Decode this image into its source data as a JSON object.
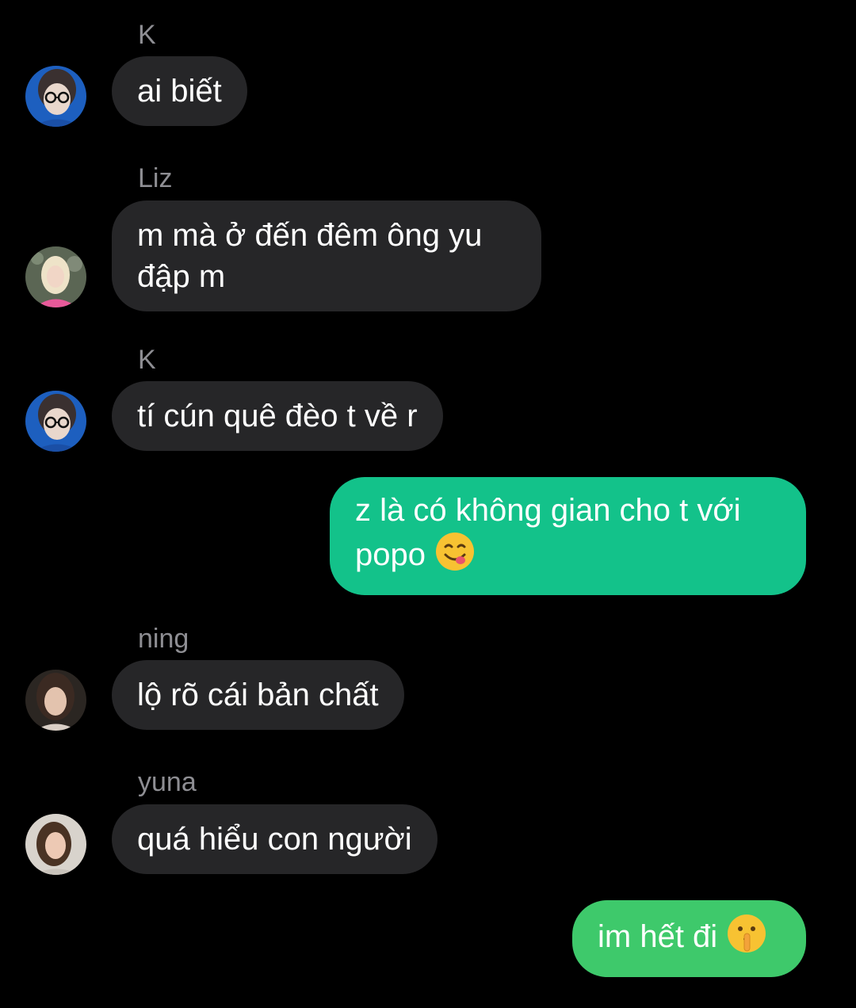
{
  "messages": [
    {
      "sender": "K",
      "text": "ai biết",
      "avatar": "avatar-k"
    },
    {
      "sender": "Liz",
      "text": "m mà ở đến đêm ông yu đập m",
      "avatar": "avatar-liz"
    },
    {
      "sender": "K",
      "text": "tí cún quê đèo t về r",
      "avatar": "avatar-k"
    },
    {
      "sender": "",
      "text": "z là có không gian cho t với popo",
      "emoji": "face-savoring-food-emoji"
    },
    {
      "sender": "ning",
      "text": "lộ rõ cái bản chất",
      "avatar": "avatar-ning"
    },
    {
      "sender": "yuna",
      "text": "quá hiểu con người",
      "avatar": "avatar-yuna"
    },
    {
      "sender": "",
      "text": "im hết đi",
      "emoji": "shushing-face-emoji"
    }
  ],
  "colors": {
    "background": "#000000",
    "incoming_bubble": "#262628",
    "outgoing_bubble_1": "#13c28a",
    "outgoing_bubble_2": "#3ec96b",
    "sender_name": "#8e8e93"
  }
}
